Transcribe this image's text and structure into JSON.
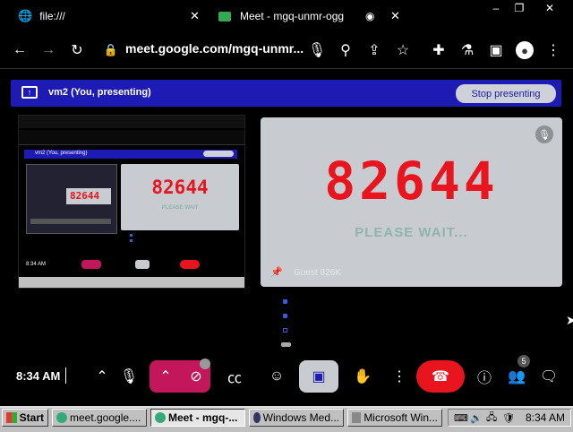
{
  "browser": {
    "tabs": [
      {
        "title": "file:///"
      },
      {
        "title": "Meet - mgq-unmr-ogg"
      }
    ],
    "address": "meet.google.com/mgq-unmr..."
  },
  "banner": {
    "text": "vm2 (You, presenting)",
    "stop_label": "Stop presenting"
  },
  "mini_screen": {
    "banner_text": "vm2 (You, presenting)",
    "code": "82644",
    "wait": "PLEASE WAIT",
    "time": "8:34 AM"
  },
  "tile": {
    "code": "82644",
    "message": "PLEASE WAIT...",
    "name": "Guest 826K"
  },
  "controls": {
    "time": "8:34 AM",
    "participants_count": "5"
  },
  "taskbar": {
    "start": "Start",
    "items": [
      {
        "label": "meet.google...."
      },
      {
        "label": "Meet - mgq-..."
      },
      {
        "label": "Windows Med..."
      },
      {
        "label": "Microsoft Win..."
      }
    ],
    "clock": "8:34 AM"
  },
  "colors": {
    "banner": "#1e1ab4",
    "code_red": "#e8141e",
    "end_call": "#e8141e",
    "highlight_pink": "#c2185b"
  }
}
